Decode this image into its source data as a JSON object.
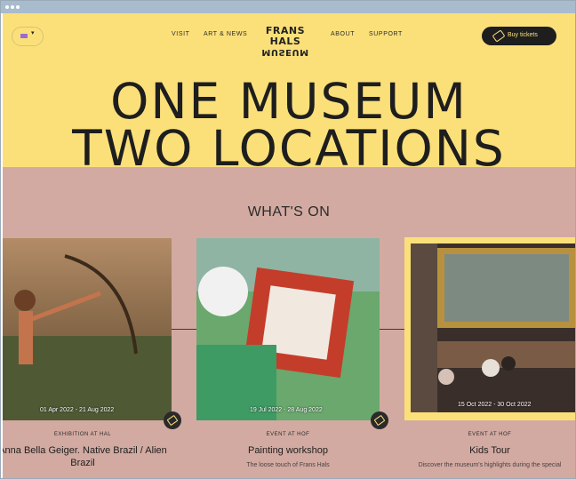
{
  "header": {
    "language_flag": "uk-flag-icon",
    "nav": [
      "VISIT",
      "ART & NEWS",
      "ABOUT",
      "SUPPORT"
    ],
    "logo_line1": "FRANS HALS",
    "logo_line2": "MUSEUM",
    "buy_label": "Buy tickets"
  },
  "hero": {
    "line1": "ONE MUSEUM",
    "line2": "TWO LOCATIONS"
  },
  "whats_on": {
    "heading": "WHAT'S ON",
    "cards": [
      {
        "dates": "01 Apr 2022 - 21 Aug 2022",
        "kicker": "EXHIBITION AT HAL",
        "title": "Anna Bella Geiger. Native Brazil / Alien Brazil",
        "description": ""
      },
      {
        "dates": "19 Jul 2022 - 28 Aug 2022",
        "kicker": "EVENT AT HOF",
        "title": "Painting workshop",
        "description": "The loose touch of Frans Hals"
      },
      {
        "dates": "15 Oct 2022 - 30 Oct 2022",
        "kicker": "EVENT AT HOF",
        "title": "Kids Tour",
        "description": "Discover the museum's highlights during the special"
      }
    ]
  },
  "colors": {
    "hero_bg": "#fbe07a",
    "section_bg": "#d2aaa1",
    "dark": "#1e1e1e"
  }
}
